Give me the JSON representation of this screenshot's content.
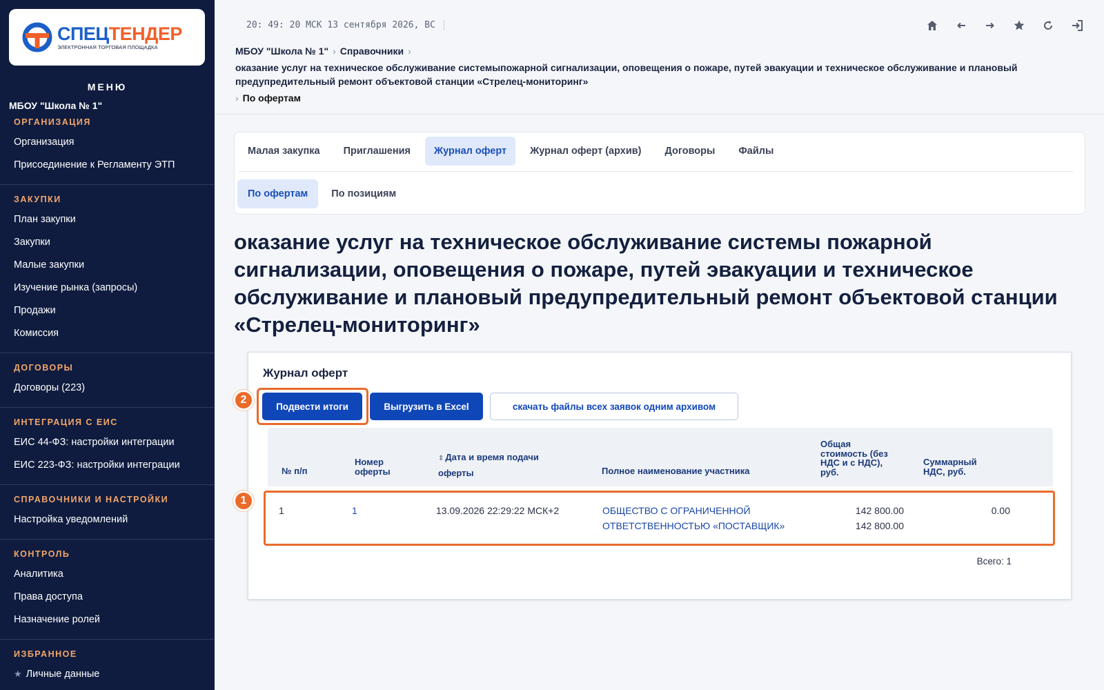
{
  "logo": {
    "part1": "СПЕЦ",
    "part2": "ТЕНДЕР",
    "subtitle": "ЭЛЕКТРОННАЯ ТОРГОВАЯ ПЛОЩАДКА"
  },
  "sidebar": {
    "menu_title": "МЕНЮ",
    "org_name": "МБОУ \"Школа № 1\"",
    "sections": [
      {
        "heading": "ОРГАНИЗАЦИЯ",
        "items": [
          "Организация",
          "Присоединение к Регламенту ЭТП"
        ]
      },
      {
        "heading": "ЗАКУПКИ",
        "items": [
          "План закупки",
          "Закупки",
          "Малые закупки",
          "Изучение рынка (запросы)",
          "Продажи",
          "Комиссия"
        ]
      },
      {
        "heading": "ДОГОВОРЫ",
        "items": [
          "Договоры (223)"
        ]
      },
      {
        "heading": "ИНТЕГРАЦИЯ С ЕИС",
        "items": [
          "ЕИС 44-ФЗ: настройки интеграции",
          "ЕИС 223-ФЗ: настройки интеграции"
        ]
      },
      {
        "heading": "СПРАВОЧНИКИ И НАСТРОЙКИ",
        "items": [
          "Настройка уведомлений"
        ]
      },
      {
        "heading": "КОНТРОЛЬ",
        "items": [
          "Аналитика",
          "Права доступа",
          "Назначение ролей"
        ]
      },
      {
        "heading": "ИЗБРАННОЕ",
        "items": [
          "Личные данные"
        ]
      }
    ]
  },
  "topbar": {
    "clock": "20: 49: 20 МСК  13 сентября 2026, ВС",
    "icons": [
      "home-icon",
      "back-arrow-icon",
      "forward-arrow-icon",
      "star-icon",
      "refresh-icon",
      "logout-icon"
    ]
  },
  "breadcrumb": {
    "org": "МБОУ \"Школа № 1\"",
    "section": "Справочники",
    "procurement": "оказание услуг на техническое обслуживание системыпожарной сигнализации, оповещения о пожаре, путей эвакуации и техническое обслуживание и плановый предупредительный ремонт объектовой станции «Стрелец-мониторинг»",
    "current": "По офертам",
    "sep": "›"
  },
  "tabs": [
    "Малая закупка",
    "Приглашения",
    "Журнал оферт",
    "Журнал оферт (архив)",
    "Договоры",
    "Файлы"
  ],
  "subtabs": [
    "По офертам",
    "По позициям"
  ],
  "page_title": "оказание услуг на техническое обслуживание системы пожарной сигнализации, оповещения о пожаре, путей эвакуации и техническое обслуживание и плановый предупредительный ремонт объектовой станции «Стрелец-мониторинг»",
  "journal": {
    "title": "Журнал оферт",
    "buttons": {
      "summarize": "Подвести итоги",
      "export": "Выгрузить в Excel",
      "download": "скачать файлы всех заявок одним архивом"
    },
    "badges": {
      "row": "1",
      "button": "2"
    },
    "columns": {
      "num": "№ п/п",
      "offer_number": "Номер оферты",
      "date": "Дата и время подачи оферты",
      "participant": "Полное наименование участника",
      "total": "Общая стоимость (без НДС и с НДС), руб.",
      "vat": "Суммарный НДС, руб."
    },
    "rows": [
      {
        "num": "1",
        "offer_number": "1",
        "date": "13.09.2026 22:29:22 МСК+2",
        "participant_line1": "ОБЩЕСТВО С ОГРАНИЧЕННОЙ",
        "participant_line2": "ОТВЕТСТВЕННОСТЬЮ «ПОСТАВЩИК»",
        "total_no_vat": "142 800.00",
        "total_with_vat": "142 800.00",
        "vat": "0.00"
      }
    ],
    "total_label": "Всего: 1"
  },
  "colors": {
    "sidebar_bg": "#0f1c3f",
    "accent_orange": "#ea6b2a",
    "primary_blue": "#1047b8",
    "section_heading": "#f3a66a"
  }
}
